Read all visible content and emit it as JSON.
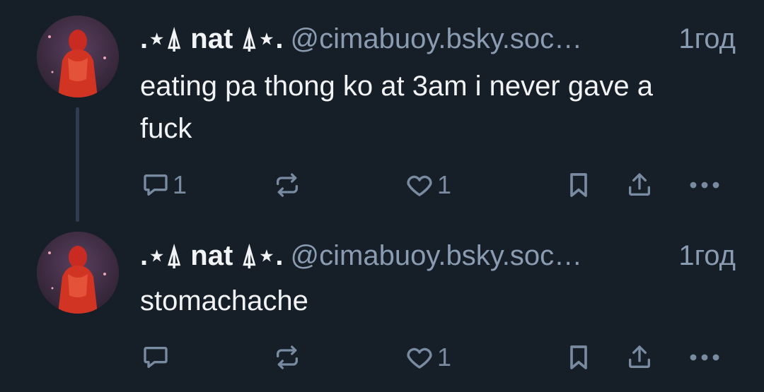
{
  "posts": [
    {
      "author_name": ".⋆⍋ nat ⍋⋆.",
      "handle": "@cimabuoy.bsky.soc…",
      "time": "1год",
      "text": "eating pa thong ko at 3am i never gave a fuck",
      "reply_count": "1",
      "repost_count": "",
      "like_count": "1"
    },
    {
      "author_name": ".⋆⍋ nat ⍋⋆.",
      "handle": "@cimabuoy.bsky.soc…",
      "time": "1год",
      "text": "stomachache",
      "reply_count": "",
      "repost_count": "",
      "like_count": "1"
    }
  ],
  "icons": {
    "reply": "speech-bubble-icon",
    "repost": "repost-arrows-icon",
    "like": "heart-outline-icon",
    "bookmark": "bookmark-icon",
    "share": "share-upload-icon",
    "more": "ellipsis-icon"
  },
  "colors": {
    "background": "#161e27",
    "text": "#f1f3f5",
    "muted": "#8a9cb1",
    "icon": "#788ba1",
    "thread_line": "#2e3c4e"
  }
}
